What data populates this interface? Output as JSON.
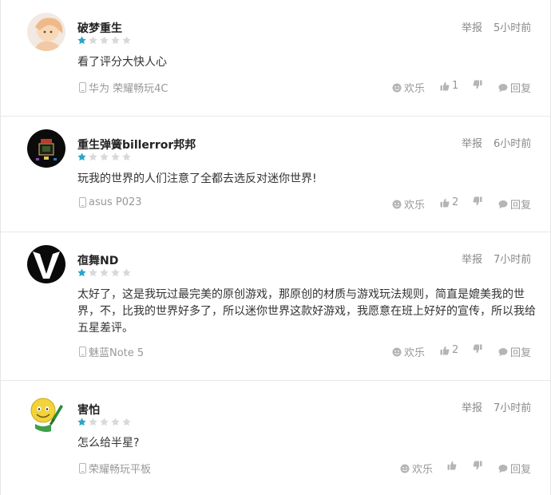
{
  "colors": {
    "star_filled": "#2aa7c9",
    "star_empty": "#d9d9d9",
    "meta_text": "#999999",
    "icon": "#b5b5b5"
  },
  "reviews": [
    {
      "username": "破梦重生",
      "rating": 1,
      "report": "举报",
      "time": "5小时前",
      "content": "看了评分大快人心",
      "device": "华为 荣耀畅玩4C",
      "happy_label": "欢乐",
      "likes": "1",
      "reply_label": "回复"
    },
    {
      "username": "重生弹簧billerror邦邦",
      "rating": 1,
      "report": "举报",
      "time": "6小时前",
      "content": "玩我的世界的人们注意了全都去选反对迷你世界!",
      "device": "asus P023",
      "happy_label": "欢乐",
      "likes": "2",
      "reply_label": "回复"
    },
    {
      "username": "亱舞ND",
      "rating": 1,
      "report": "举报",
      "time": "7小时前",
      "content": "太好了，这是我玩过最完美的原创游戏，那原创的材质与游戏玩法规则，简直是媲美我的世界，不，比我的世界好多了，所以迷你世界这款好游戏，我愿意在班上好好的宣传，所以我给五星差评。",
      "device": "魅蓝Note 5",
      "happy_label": "欢乐",
      "likes": "2",
      "reply_label": "回复"
    },
    {
      "username": "害怕",
      "rating": 1,
      "report": "举报",
      "time": "7小时前",
      "content": "怎么给半星?",
      "device": "荣耀畅玩平板",
      "happy_label": "欢乐",
      "likes": "",
      "reply_label": "回复"
    }
  ]
}
